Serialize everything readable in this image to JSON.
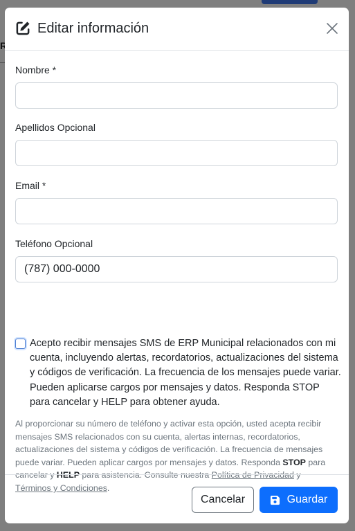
{
  "modal": {
    "title": "Editar información",
    "fields": {
      "nombre": {
        "label": "Nombre *",
        "value": ""
      },
      "apellidos": {
        "label": "Apellidos Opcional",
        "value": ""
      },
      "email": {
        "label": "Email *",
        "value": ""
      },
      "telefono": {
        "label": "Teléfono Opcional",
        "value": "(787) 000-0000"
      }
    },
    "consent": {
      "checked": false,
      "text": "Acepto recibir mensajes SMS de ERP Municipal relacionados con mi cuenta, incluyendo alertas, recordatorios, actualizaciones del sistema y códigos de verificación. La frecuencia de los mensajes puede variar. Pueden aplicarse cargos por mensajes y datos. Responda STOP para cancelar y HELP para obtener ayuda."
    },
    "help": {
      "part1": "Al proporcionar su número de teléfono y activar esta opción, usted acepta recibir mensajes SMS relacionados con su cuenta, alertas internas, recordatorios, actualizaciones del sistema y códigos de verificación. La frecuencia de mensajes puede variar. Pueden aplicar cargos por mensajes y datos. Responda ",
      "stop": "STOP",
      "part2": " para cancelar y ",
      "help_word": "HELP",
      "part3": " para asistencia. Consulte nuestra ",
      "privacy_link": "Política de Privacidad",
      "and": " y ",
      "terms_link": "Términos y Condiciones",
      "end": "."
    },
    "footer": {
      "cancel_label": "Cancelar",
      "save_label": "Guardar"
    }
  },
  "background": {
    "letter": "R"
  },
  "colors": {
    "primary": "#0d6efd",
    "border": "#ced4da",
    "muted": "#6c757d",
    "text": "#212529"
  }
}
